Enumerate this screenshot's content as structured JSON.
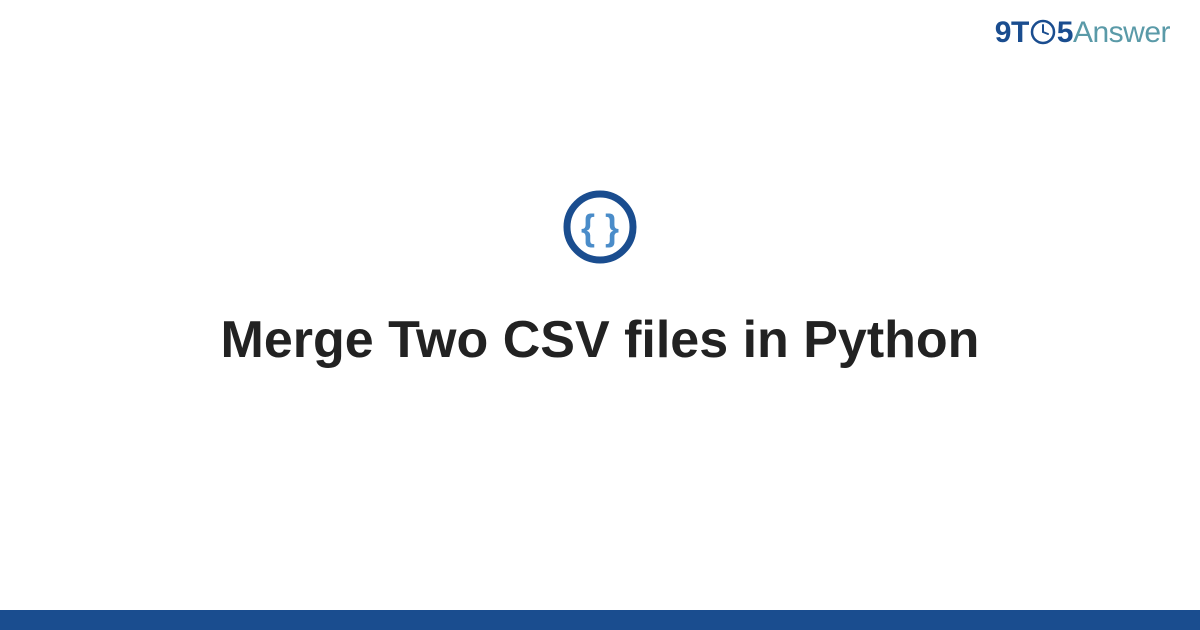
{
  "header": {
    "logo_9": "9",
    "logo_t": "T",
    "logo_5": "5",
    "logo_answer": "Answer"
  },
  "content": {
    "title": "Merge Two CSV files in Python"
  },
  "colors": {
    "brand_primary": "#1a4d8f",
    "brand_secondary": "#5a9aa8",
    "icon_ring": "#1a4d8f",
    "icon_braces": "#4a8cc9"
  }
}
